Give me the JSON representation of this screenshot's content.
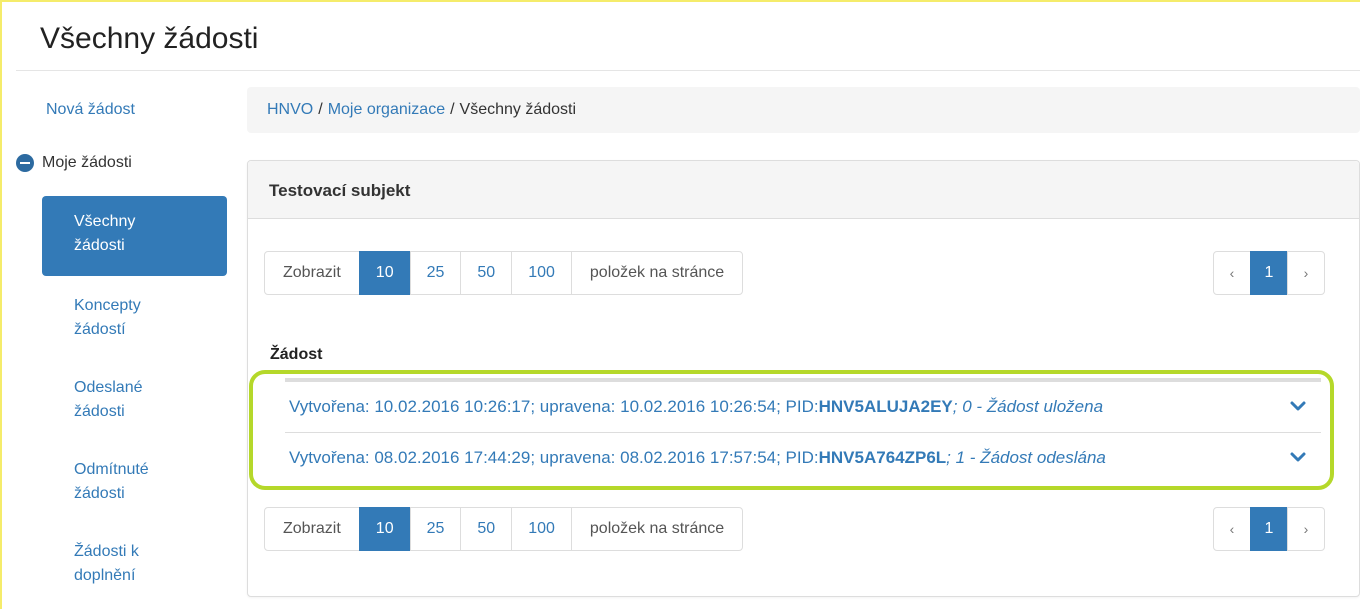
{
  "page": {
    "title": "Všechny žádosti"
  },
  "sidebar": {
    "new_request": "Nová žádost",
    "my_requests": "Moje žádosti",
    "items": [
      {
        "label": "Všechny žádosti",
        "active": true
      },
      {
        "label": "Koncepty žádostí",
        "active": false
      },
      {
        "label": "Odeslané žádosti",
        "active": false
      },
      {
        "label": "Odmítnuté žádosti",
        "active": false
      },
      {
        "label": "Žádosti k doplnění",
        "active": false
      }
    ]
  },
  "breadcrumb": {
    "items": [
      "HNVO",
      "Moje organizace"
    ],
    "separator": "/",
    "current": "Všechny žádosti"
  },
  "panel": {
    "heading": "Testovací subjekt",
    "page_size": {
      "prefix": "Zobrazit",
      "options": [
        "10",
        "25",
        "50",
        "100"
      ],
      "selected": "10",
      "suffix": "položek na stránce"
    },
    "pagination": {
      "prev": "‹",
      "current": "1",
      "next": "›"
    },
    "column_header": "Žádost",
    "rows": [
      {
        "text": "Vytvořena: 10.02.2016 10:26:17; upravena: 10.02.2016 10:26:54; PID: ",
        "pid": "HNV5ALUJA2EY",
        "status": "; 0 - Žádost uložena"
      },
      {
        "text": "Vytvořena: 08.02.2016 17:44:29; upravena: 08.02.2016 17:57:54; PID: ",
        "pid": "HNV5A764ZP6L",
        "status": "; 1 - Žádost odeslána"
      }
    ]
  },
  "colors": {
    "accent": "#337ab7",
    "highlight": "#b5d82a",
    "frame": "#f5ec6b"
  }
}
